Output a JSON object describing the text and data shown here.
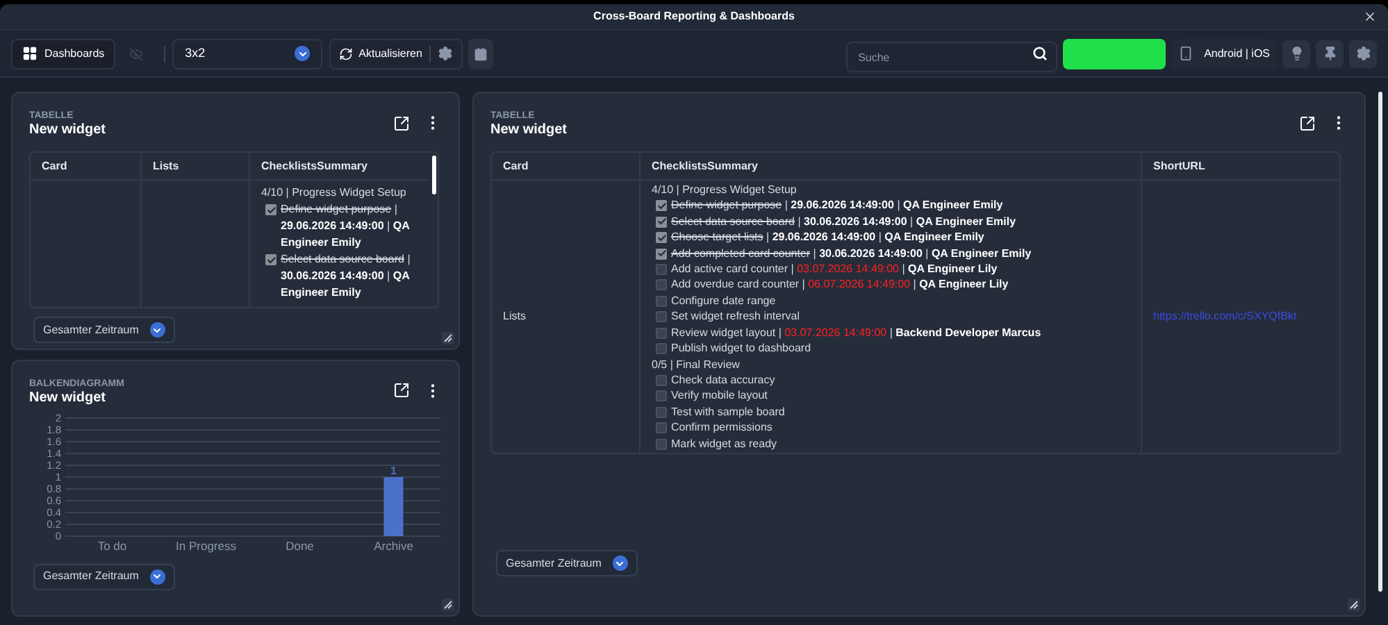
{
  "window": {
    "title": "Cross-Board Reporting & Dashboards"
  },
  "toolbar": {
    "dashboards_button": "Dashboards",
    "layout_select": "3x2",
    "refresh_button": "Aktualisieren",
    "search": {
      "placeholder": "Suche"
    },
    "platform_button": "Android | iOS"
  },
  "widgets": [
    {
      "kind": "table",
      "type_label": "TABELLE",
      "title": "New widget",
      "range_select": "Gesamter Zeitraum",
      "columns": [
        "Card",
        "Lists",
        "ChecklistsSummary"
      ],
      "rows": [
        {
          "cells": [
            {
              "kind": "blank"
            },
            {
              "kind": "blank"
            },
            {
              "kind": "checklists",
              "separator": "|",
              "checklists": [
                {
                  "header": "4/10 | Progress Widget Setup",
                  "items": [
                    {
                      "text": "Define widget purpose",
                      "checked": true,
                      "date": "29.06.2026 14:49:00",
                      "overdue": false,
                      "person": "QA Engineer Emily"
                    },
                    {
                      "text": "Select data source board",
                      "checked": true,
                      "date": "30.06.2026 14:49:00",
                      "overdue": false,
                      "person": "QA Engineer Emily"
                    }
                  ]
                }
              ]
            }
          ]
        }
      ]
    },
    {
      "kind": "chart",
      "type_label": "BALKENDIAGRAMM",
      "title": "New widget",
      "range_select": "Gesamter Zeitraum",
      "chart_data": {
        "type": "bar",
        "categories": [
          "To do",
          "In Progress",
          "Done",
          "Archive"
        ],
        "values": [
          0,
          0,
          0,
          1
        ],
        "ylim": [
          0,
          2
        ],
        "yticks": [
          0,
          {
            "value": 0.2,
            "label": "0.2"
          },
          {
            "value": 0.4,
            "label": "0.4"
          },
          {
            "value": 0.6,
            "label": "0.6"
          },
          {
            "value": 0.8,
            "label": "0.8"
          },
          1,
          {
            "value": 1.2,
            "label": "1.2"
          },
          {
            "value": 1.4,
            "label": "1.4"
          },
          {
            "value": 1.6,
            "label": "1.6"
          },
          {
            "value": 1.8,
            "label": "1.8"
          },
          2
        ],
        "grid": true,
        "value_labels": [
          null,
          null,
          null,
          "1"
        ]
      }
    },
    {
      "kind": "table",
      "type_label": "TABELLE",
      "title": "New widget",
      "range_select": "Gesamter Zeitraum",
      "columns": [
        "Card",
        "ChecklistsSummary",
        "ShortURL"
      ],
      "rows": [
        {
          "cells": [
            {
              "kind": "text",
              "text": "Lists"
            },
            {
              "kind": "checklists",
              "separator": "|",
              "checklists": [
                {
                  "header": "4/10 | Progress Widget Setup",
                  "items": [
                    {
                      "text": "Define widget purpose",
                      "checked": true,
                      "date": "29.06.2026 14:49:00",
                      "overdue": false,
                      "person": "QA Engineer Emily"
                    },
                    {
                      "text": "Select data source board",
                      "checked": true,
                      "date": "30.06.2026 14:49:00",
                      "overdue": false,
                      "person": "QA Engineer Emily"
                    },
                    {
                      "text": "Choose target lists",
                      "checked": true,
                      "date": "29.06.2026 14:49:00",
                      "overdue": false,
                      "person": "QA Engineer Emily"
                    },
                    {
                      "text": "Add completed card counter",
                      "checked": true,
                      "date": "30.06.2026 14:49:00",
                      "overdue": false,
                      "person": "QA Engineer Emily"
                    },
                    {
                      "text": "Add active card counter",
                      "checked": false,
                      "date": "03.07.2026 14:49:00",
                      "overdue": true,
                      "person": "QA Engineer Lily"
                    },
                    {
                      "text": "Add overdue card counter",
                      "checked": false,
                      "date": "06.07.2026 14:49:00",
                      "overdue": true,
                      "person": "QA Engineer Lily"
                    },
                    {
                      "text": "Configure date range",
                      "checked": false
                    },
                    {
                      "text": "Set widget refresh interval",
                      "checked": false
                    },
                    {
                      "text": "Review widget layout",
                      "checked": false,
                      "date": "03.07.2026 14:49:00",
                      "overdue": true,
                      "person": "Backend Developer Marcus"
                    },
                    {
                      "text": "Publish widget to dashboard",
                      "checked": false
                    }
                  ]
                },
                {
                  "header": "0/5 | Final Review",
                  "items": [
                    {
                      "text": "Check data accuracy",
                      "checked": false
                    },
                    {
                      "text": "Verify mobile layout",
                      "checked": false
                    },
                    {
                      "text": "Test with sample board",
                      "checked": false
                    },
                    {
                      "text": "Confirm permissions",
                      "checked": false
                    },
                    {
                      "text": "Mark widget as ready",
                      "checked": false
                    }
                  ]
                }
              ]
            },
            {
              "kind": "link",
              "text": "https://trello.com/c/SXYQfBkt"
            }
          ]
        }
      ]
    }
  ]
}
